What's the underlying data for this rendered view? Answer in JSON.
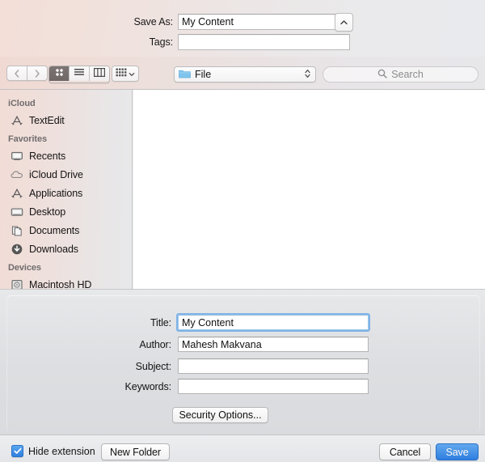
{
  "top": {
    "save_as_label": "Save As:",
    "save_as_value": "My Content",
    "tags_label": "Tags:",
    "tags_value": "",
    "collapse_icon": "chevron-up-icon"
  },
  "toolbar": {
    "back_icon": "chevron-left-icon",
    "forward_icon": "chevron-right-icon",
    "view_modes": [
      {
        "name": "icon-view",
        "icon": "grid-icon",
        "selected": true
      },
      {
        "name": "list-view",
        "icon": "list-icon",
        "selected": false
      },
      {
        "name": "column-view",
        "icon": "columns-icon",
        "selected": false
      }
    ],
    "arrange_icon": "arrange-grid-icon",
    "arrange_chevron_icon": "chevron-down-icon",
    "path_icon": "folder-icon",
    "path_label": "File",
    "path_stepper_icon": "up-down-chevron-icon",
    "search_icon": "search-icon",
    "search_placeholder": "Search"
  },
  "sidebar": {
    "sections": [
      {
        "header": "iCloud",
        "items": [
          {
            "label": "TextEdit",
            "icon": "app-icon"
          }
        ]
      },
      {
        "header": "Favorites",
        "items": [
          {
            "label": "Recents",
            "icon": "recents-icon"
          },
          {
            "label": "iCloud Drive",
            "icon": "cloud-icon"
          },
          {
            "label": "Applications",
            "icon": "applications-icon"
          },
          {
            "label": "Desktop",
            "icon": "desktop-icon"
          },
          {
            "label": "Documents",
            "icon": "documents-icon"
          },
          {
            "label": "Downloads",
            "icon": "downloads-icon"
          }
        ]
      },
      {
        "header": "Devices",
        "items": [
          {
            "label": "Macintosh HD",
            "icon": "harddisk-icon"
          }
        ]
      }
    ]
  },
  "accessory": {
    "fields": [
      {
        "label": "Title:",
        "value": "My Content",
        "focused": true
      },
      {
        "label": "Author:",
        "value": "Mahesh Makvana",
        "focused": false
      },
      {
        "label": "Subject:",
        "value": "",
        "focused": false
      },
      {
        "label": "Keywords:",
        "value": "",
        "focused": false
      }
    ],
    "security_button": "Security Options..."
  },
  "bottom": {
    "hide_extension_label": "Hide extension",
    "hide_extension_checked": true,
    "check_icon": "check-icon",
    "new_folder_label": "New Folder",
    "cancel_label": "Cancel",
    "save_label": "Save"
  },
  "colors": {
    "accent_blue": "#2e7ee0",
    "focus_ring": "#7fb4e6",
    "folder_blue": "#7fc4ec",
    "panel_gray": "#dcdee1"
  }
}
